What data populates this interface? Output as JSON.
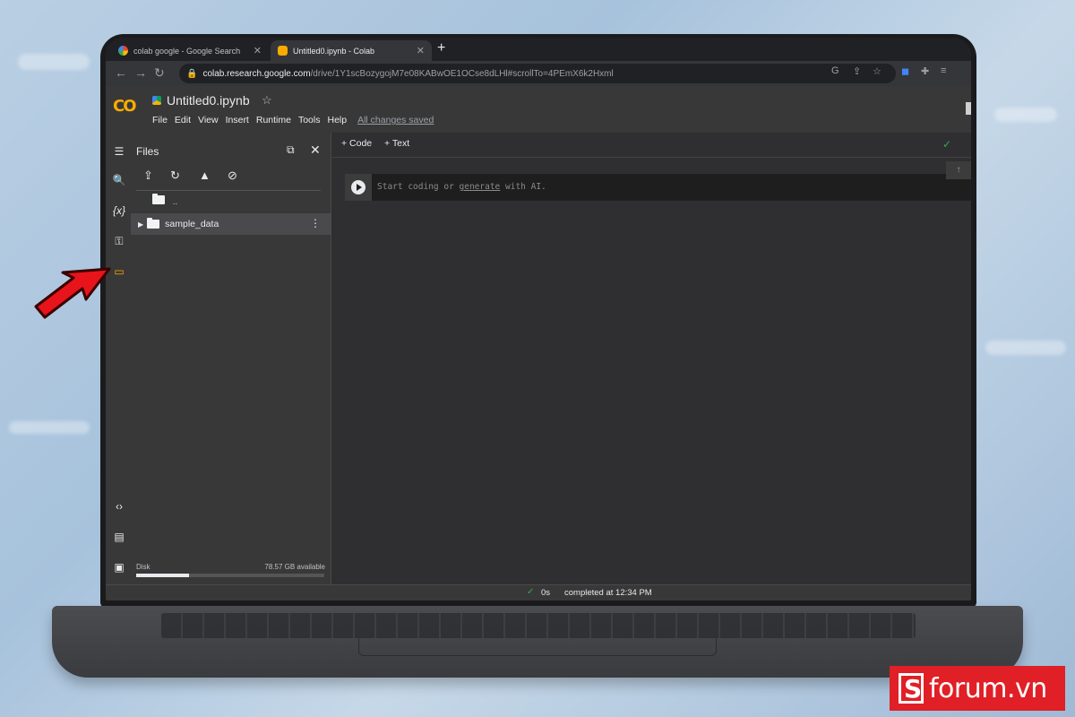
{
  "browser": {
    "tabs": [
      {
        "title": "colab google - Google Search",
        "favicon": "google-icon"
      },
      {
        "title": "Untitled0.ipynb - Colab",
        "favicon": "colab-icon"
      }
    ],
    "new_tab": "+",
    "url_host": "colab.research.google.com",
    "url_path": "/drive/1Y1scBozygojM7e08KABwOE1OCse8dLHl#scrollTo=4PEmX6k2Hxml"
  },
  "colab": {
    "logo_text": "CO",
    "notebook_title": "Untitled0.ipynb",
    "menu": [
      "File",
      "Edit",
      "View",
      "Insert",
      "Runtime",
      "Tools",
      "Help"
    ],
    "save_status": "All changes saved"
  },
  "files_panel": {
    "title": "Files",
    "parent_dir": "..",
    "items": [
      {
        "name": "sample_data",
        "type": "folder"
      }
    ],
    "disk_label": "Disk",
    "disk_available": "78.57 GB available",
    "disk_used_fraction": 0.28
  },
  "toolbar": {
    "add_code": "+ Code",
    "add_text": "+ Text"
  },
  "cell": {
    "placeholder_before": "Start coding or ",
    "placeholder_link": "generate",
    "placeholder_after": " with AI."
  },
  "status": {
    "elapsed": "0s",
    "message": "completed at 12:34 PM"
  },
  "watermark": {
    "text": "forum.vn"
  },
  "colors": {
    "colab_orange": "#f9ab00",
    "highlight_arrow": "#e8141b",
    "success_green": "#34a853",
    "watermark_red": "#e01f26"
  }
}
